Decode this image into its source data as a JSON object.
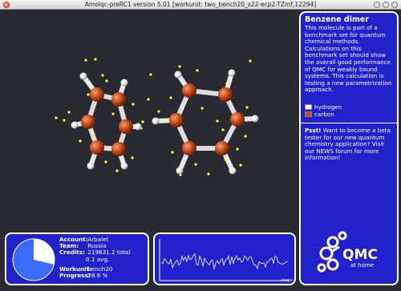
{
  "window": {
    "title": "Amolqc-preRC1 version 5.01 [workunit: two_bench20_s22-ecp2-TZmf,12294]"
  },
  "info_panel": {
    "heading": "Benzene dimer",
    "description": "This molecule is part of a benchmark set for quantum chemical methods. Calculations on this benchmark set should show the overall good performance of QMC for weakly bound systems. This calculation is testing a new parametrization approach.",
    "legend": [
      {
        "label": "hydrogen",
        "color": "#ffffff"
      },
      {
        "label": "carbon",
        "color": "#c84a1a"
      }
    ],
    "psst_label": "Psst!",
    "psst_text": " Want to become a beta tester for our new quantum chemistry application? Visit our NEWS forum for more information!",
    "logo_main": "QMC",
    "logo_sub": "at home"
  },
  "stats": {
    "account_label": "Account:",
    "account_value": "Arbalet",
    "team_label": "Team:",
    "team_value": "Russia",
    "credits_label": "Credits:",
    "credits_total": "219631.2 total",
    "credits_avg": "0.1 avg.",
    "workunit_label": "Workunit:",
    "workunit_value": "bench20",
    "progress_label": "Progress:",
    "progress_value": "28.6 %",
    "progress_fraction": 0.286
  },
  "graph": {
    "x_label": "steps"
  },
  "colors": {
    "panel_bg": "#2222cc",
    "panel_border": "#ffffff",
    "scene_bg": "#2a2a32",
    "carbon": "#c84a1a",
    "hydrogen": "#ffffff",
    "electron": "#ffff33"
  },
  "icons": {
    "close": "close-icon",
    "minimize": "minimize-icon",
    "maximize": "maximize-icon",
    "restore": "restore-icon"
  }
}
